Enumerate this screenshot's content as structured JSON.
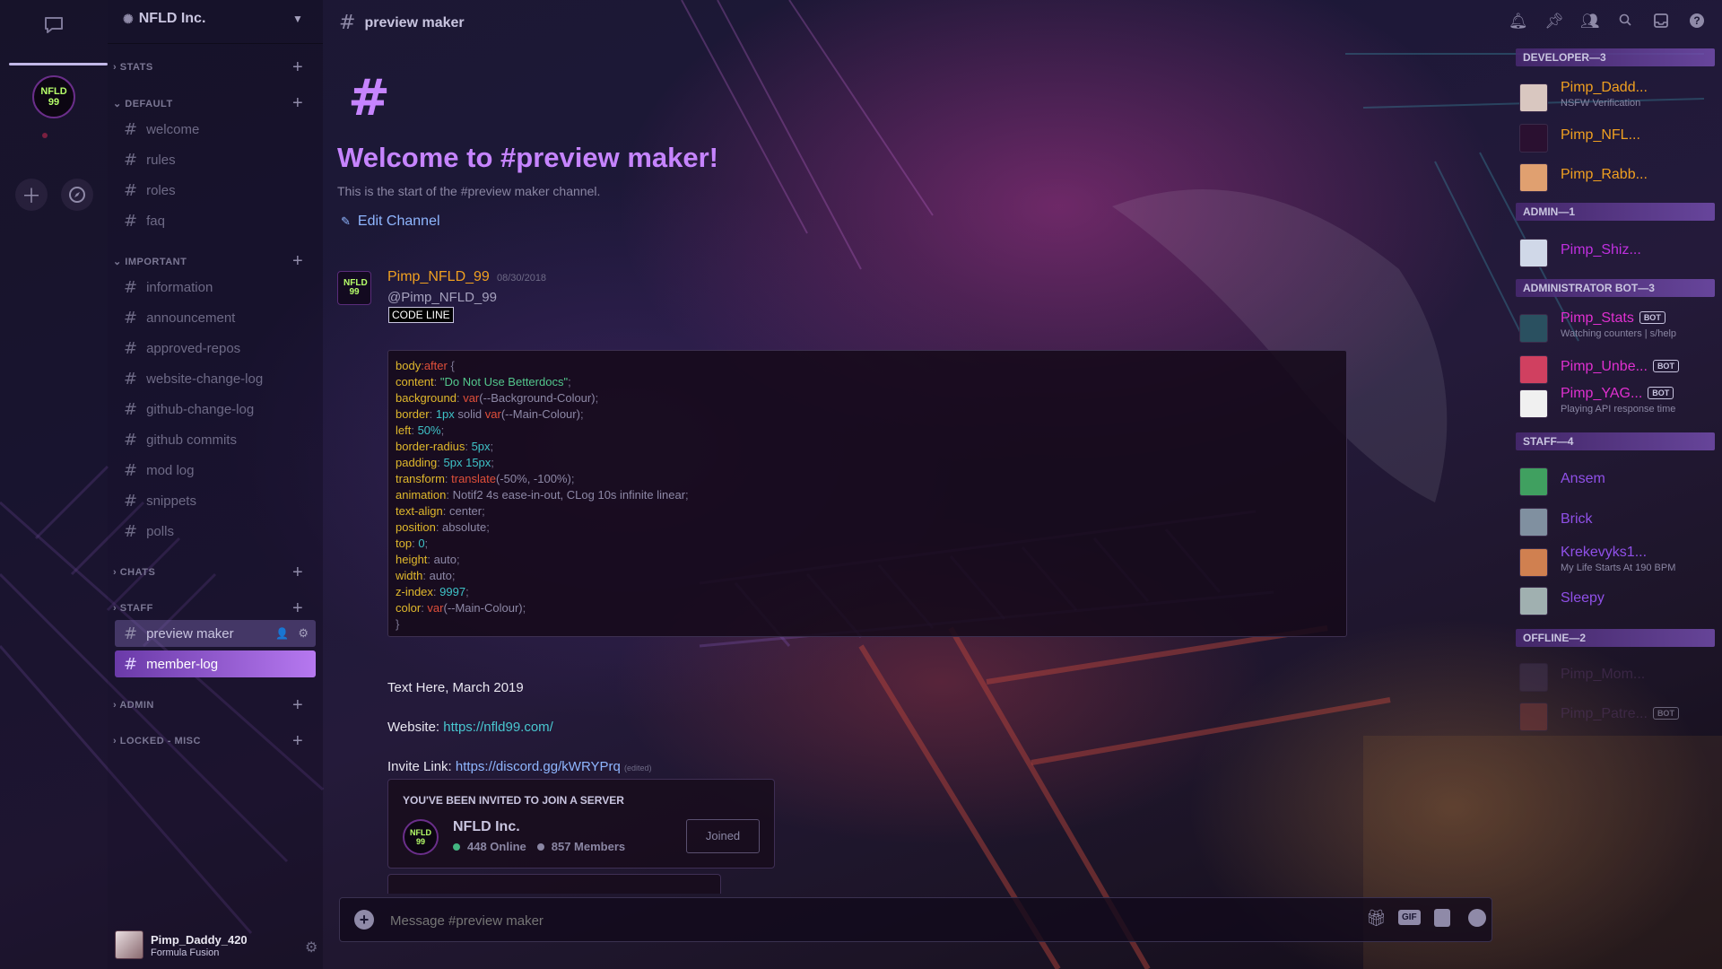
{
  "server": {
    "name": "NFLD Inc.",
    "avatar_text": "NFLD 99"
  },
  "categories": [
    {
      "label": "STATS"
    },
    {
      "label": "DEFAULT"
    },
    {
      "label": "IMPORTANT"
    },
    {
      "label": "CHATS"
    },
    {
      "label": "STAFF"
    },
    {
      "label": "ADMIN"
    },
    {
      "label": "LOCKED - MISC"
    }
  ],
  "channels": {
    "default": [
      "welcome",
      "rules",
      "roles",
      "faq"
    ],
    "important": [
      "information",
      "announcement",
      "approved-repos",
      "website-change-log",
      "github-change-log",
      "github commits",
      "mod log",
      "snippets",
      "polls"
    ],
    "staff": [
      "preview maker",
      "member-log"
    ]
  },
  "header": {
    "channel": "preview maker"
  },
  "welcome": {
    "title": "Welcome to #preview maker!",
    "description": "This is the start of the #preview maker channel.",
    "edit_label": "Edit Channel"
  },
  "message": {
    "author": "Pimp_NFLD_99",
    "timestamp": "08/30/2018",
    "mention": "@Pimp_NFLD_99",
    "badge": "CODE LINE",
    "text1": "Text Here, March 2019",
    "website_label": "Website:",
    "website_url": "https://nfld99.com/",
    "invite_label": "Invite Link:",
    "invite_url": "https://discord.gg/kWRYPrq",
    "edited": "(edited)"
  },
  "code": {
    "selector": "body",
    "pseudo": ":after",
    "lines": [
      {
        "prop": "content",
        "val": "\"Do Not Use Betterdocs\"",
        "kind": "s"
      },
      {
        "prop": "background",
        "fn": "var",
        "arg": "(--Background-Colour)"
      },
      {
        "prop": "border",
        "val": "1px",
        "kind": "n",
        "rest": " solid ",
        "fn": "var",
        "arg": "(--Main-Colour)"
      },
      {
        "prop": "left",
        "val": "50%",
        "kind": "n"
      },
      {
        "prop": "border-radius",
        "val": "5px",
        "kind": "n"
      },
      {
        "prop": "padding",
        "val": "5px 15px",
        "kind": "n"
      },
      {
        "prop": "transform",
        "fn": "translate",
        "arg": "(-50%, -100%)"
      },
      {
        "prop": "animation",
        "val": "Notif2 4s ease-in-out, CLog 10s infinite linear",
        "kind": "w"
      },
      {
        "prop": "text-align",
        "val": "center",
        "kind": "w"
      },
      {
        "prop": "position",
        "val": "absolute",
        "kind": "w"
      },
      {
        "prop": "top",
        "val": "0",
        "kind": "n"
      },
      {
        "prop": "height",
        "val": "auto",
        "kind": "w"
      },
      {
        "prop": "width",
        "val": "auto",
        "kind": "w"
      },
      {
        "prop": "z-index",
        "val": "9997",
        "kind": "n"
      },
      {
        "prop": "color",
        "fn": "var",
        "arg": "(--Main-Colour)"
      }
    ]
  },
  "invite": {
    "heading": "YOU'VE BEEN INVITED TO JOIN A SERVER",
    "server": "NFLD Inc.",
    "online": "448 Online",
    "members": "857 Members",
    "button": "Joined"
  },
  "input": {
    "placeholder": "Message #preview maker"
  },
  "user": {
    "name": "Pimp_Daddy_420",
    "status": "Formula Fusion"
  },
  "members": [
    {
      "group": "DEVELOPER—3",
      "items": [
        {
          "name": "Pimp_Dadd...",
          "sub": "NSFW Verification",
          "color": "#f0a020",
          "av": "#d9c7c0"
        },
        {
          "name": "Pimp_NFL...",
          "sub": "",
          "color": "#f0a020",
          "av": "#2a1030"
        },
        {
          "name": "Pimp_Rabb...",
          "sub": "",
          "color": "#f0a020",
          "av": "#e0a070"
        }
      ]
    },
    {
      "group": "ADMIN—1",
      "items": [
        {
          "name": "Pimp_Shiz...",
          "sub": "",
          "color": "#c030e0",
          "av": "#d0d8e8"
        }
      ]
    },
    {
      "group": "ADMINISTRATOR BOT—3",
      "items": [
        {
          "name": "Pimp_Stats",
          "sub": "Watching counters | s/help",
          "color": "#e030d0",
          "av": "#2a5060",
          "bot": "BOT"
        },
        {
          "name": "Pimp_Unbe...",
          "sub": "",
          "color": "#e030d0",
          "av": "#d04060",
          "bot": "BOT"
        },
        {
          "name": "Pimp_YAG...",
          "sub": "Playing API response time",
          "color": "#e030d0",
          "av": "#f0f0f0",
          "bot": "BOT"
        }
      ]
    },
    {
      "group": "STAFF—4",
      "items": [
        {
          "name": "Ansem",
          "sub": "",
          "color": "#9050e8",
          "av": "#40a060"
        },
        {
          "name": "Brick",
          "sub": "",
          "color": "#9050e8",
          "av": "#8090a0"
        },
        {
          "name": "Krekevyks1...",
          "sub": "My Life Starts At 190 BPM",
          "color": "#9050e8",
          "av": "#d08050"
        },
        {
          "name": "Sleepy",
          "sub": "",
          "color": "#9050e8",
          "av": "#a0b0b0"
        }
      ]
    },
    {
      "group": "OFFLINE—2",
      "items": [
        {
          "name": "Pimp_Mom...",
          "sub": "",
          "color": "#5a3a6a",
          "av": "#4a3a5a"
        },
        {
          "name": "Pimp_Patre...",
          "sub": "",
          "color": "#5a3a6a",
          "av": "#8a4040",
          "bot": "BOT"
        }
      ]
    }
  ]
}
